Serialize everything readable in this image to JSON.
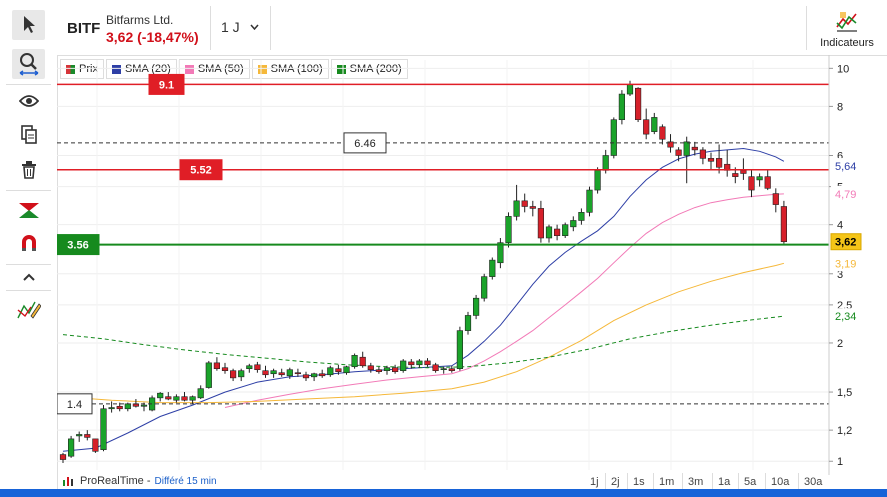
{
  "header": {
    "symbol": "BITF",
    "company": "Bitfarms Ltd.",
    "quote": "3,62 (-18,47%)",
    "period": "1 J",
    "indicators_label": "Indicateurs"
  },
  "toolbar": {
    "tools": [
      "cursor-icon",
      "zoom-icon",
      "eye-icon",
      "copy-icon",
      "trash-icon",
      "trend-icon",
      "magnet-icon",
      "chevron-up-icon",
      "pencil-icon"
    ]
  },
  "legend": [
    {
      "label": "Prix",
      "color": "#d6353a"
    },
    {
      "label": "SMA (20)",
      "color": "#2e3fa6"
    },
    {
      "label": "SMA (50)",
      "color": "#f27ab7"
    },
    {
      "label": "SMA (100)",
      "color": "#f5b83a"
    },
    {
      "label": "SMA (200)",
      "color": "#168a1e"
    }
  ],
  "price_lines": [
    {
      "label": "9.1",
      "value": 9.1,
      "color": "#e01e26",
      "style": "solid"
    },
    {
      "label": "6.46",
      "value": 6.46,
      "color": "#333333",
      "style": "dashed"
    },
    {
      "label": "5.52",
      "value": 5.52,
      "color": "#e01e26",
      "style": "solid"
    },
    {
      "label": "3.56",
      "value": 3.56,
      "color": "#168a1e",
      "style": "solid"
    },
    {
      "label": "1.4",
      "value": 1.4,
      "color": "#333333",
      "style": "dashed"
    }
  ],
  "axis_badges": [
    {
      "label": "5,64",
      "color": "#2e3fa6",
      "bg": "#ffffff",
      "value": 5.64
    },
    {
      "label": "4,79",
      "color": "#f27ab7",
      "bg": "#ffffff",
      "value": 4.79
    },
    {
      "label": "3,62",
      "color": "#000000",
      "bg": "#f5c518",
      "value": 3.62
    },
    {
      "label": "3,19",
      "color": "#f5b83a",
      "bg": "#ffffff",
      "value": 3.19
    },
    {
      "label": "2,34",
      "color": "#168a1e",
      "bg": "#ffffff",
      "value": 2.34
    }
  ],
  "footer": {
    "source": "ProRealTime -",
    "delay": "Différé 15 min",
    "ranges": [
      "1j",
      "2j",
      "1s",
      "1m",
      "3m",
      "1a",
      "5a",
      "10a",
      "30a"
    ]
  },
  "chart_data": {
    "type": "candlestick",
    "yscale": "log",
    "ylim": [
      0.95,
      10.5
    ],
    "yticks": [
      {
        "label": "10",
        "value": 10
      },
      {
        "label": "8",
        "value": 8
      },
      {
        "label": "6",
        "value": 6
      },
      {
        "label": "5",
        "value": 5
      },
      {
        "label": "4",
        "value": 4
      },
      {
        "label": "3",
        "value": 3
      },
      {
        "label": "2,5",
        "value": 2.5
      },
      {
        "label": "2",
        "value": 2
      },
      {
        "label": "1,5",
        "value": 1.5
      },
      {
        "label": "1,2",
        "value": 1.2
      },
      {
        "label": "1",
        "value": 1
      }
    ],
    "candles": [
      [
        1.04,
        1.05,
        0.99,
        1.01
      ],
      [
        1.03,
        1.16,
        1.02,
        1.14
      ],
      [
        1.16,
        1.19,
        1.12,
        1.17
      ],
      [
        1.17,
        1.2,
        1.13,
        1.15
      ],
      [
        1.14,
        1.14,
        1.05,
        1.06
      ],
      [
        1.07,
        1.39,
        1.06,
        1.36
      ],
      [
        1.36,
        1.42,
        1.33,
        1.37
      ],
      [
        1.38,
        1.41,
        1.34,
        1.36
      ],
      [
        1.36,
        1.41,
        1.34,
        1.4
      ],
      [
        1.4,
        1.44,
        1.37,
        1.38
      ],
      [
        1.38,
        1.41,
        1.34,
        1.39
      ],
      [
        1.35,
        1.47,
        1.34,
        1.45
      ],
      [
        1.45,
        1.5,
        1.42,
        1.49
      ],
      [
        1.46,
        1.5,
        1.43,
        1.44
      ],
      [
        1.43,
        1.48,
        1.41,
        1.46
      ],
      [
        1.46,
        1.5,
        1.42,
        1.43
      ],
      [
        1.43,
        1.47,
        1.4,
        1.46
      ],
      [
        1.45,
        1.56,
        1.44,
        1.53
      ],
      [
        1.54,
        1.8,
        1.53,
        1.78
      ],
      [
        1.78,
        1.84,
        1.7,
        1.72
      ],
      [
        1.73,
        1.78,
        1.67,
        1.7
      ],
      [
        1.7,
        1.72,
        1.6,
        1.63
      ],
      [
        1.64,
        1.72,
        1.6,
        1.7
      ],
      [
        1.72,
        1.77,
        1.68,
        1.75
      ],
      [
        1.76,
        1.79,
        1.68,
        1.71
      ],
      [
        1.7,
        1.75,
        1.63,
        1.66
      ],
      [
        1.67,
        1.72,
        1.63,
        1.7
      ],
      [
        1.68,
        1.72,
        1.64,
        1.66
      ],
      [
        1.65,
        1.73,
        1.62,
        1.71
      ],
      [
        1.68,
        1.72,
        1.64,
        1.67
      ],
      [
        1.66,
        1.69,
        1.6,
        1.63
      ],
      [
        1.64,
        1.68,
        1.6,
        1.67
      ],
      [
        1.67,
        1.71,
        1.63,
        1.65
      ],
      [
        1.66,
        1.75,
        1.64,
        1.73
      ],
      [
        1.72,
        1.76,
        1.66,
        1.69
      ],
      [
        1.68,
        1.75,
        1.66,
        1.74
      ],
      [
        1.74,
        1.88,
        1.72,
        1.86
      ],
      [
        1.84,
        1.9,
        1.73,
        1.75
      ],
      [
        1.75,
        1.78,
        1.68,
        1.71
      ],
      [
        1.71,
        1.74,
        1.67,
        1.69
      ],
      [
        1.7,
        1.75,
        1.66,
        1.73
      ],
      [
        1.73,
        1.76,
        1.67,
        1.69
      ],
      [
        1.7,
        1.82,
        1.68,
        1.8
      ],
      [
        1.79,
        1.82,
        1.72,
        1.76
      ],
      [
        1.76,
        1.82,
        1.73,
        1.8
      ],
      [
        1.8,
        1.83,
        1.74,
        1.76
      ],
      [
        1.76,
        1.78,
        1.68,
        1.7
      ],
      [
        1.71,
        1.74,
        1.67,
        1.72
      ],
      [
        1.72,
        1.75,
        1.68,
        1.7
      ],
      [
        1.72,
        2.2,
        1.7,
        2.15
      ],
      [
        2.15,
        2.4,
        2.1,
        2.35
      ],
      [
        2.35,
        2.65,
        2.3,
        2.6
      ],
      [
        2.6,
        3.0,
        2.55,
        2.95
      ],
      [
        2.95,
        3.3,
        2.9,
        3.25
      ],
      [
        3.2,
        3.7,
        3.1,
        3.6
      ],
      [
        3.6,
        4.3,
        3.5,
        4.2
      ],
      [
        4.2,
        5.05,
        4.1,
        4.6
      ],
      [
        4.6,
        4.8,
        4.3,
        4.45
      ],
      [
        4.45,
        4.6,
        4.2,
        4.4
      ],
      [
        4.4,
        4.6,
        3.6,
        3.7
      ],
      [
        3.7,
        4.0,
        3.6,
        3.95
      ],
      [
        3.9,
        4.0,
        3.65,
        3.75
      ],
      [
        3.75,
        4.05,
        3.7,
        4.0
      ],
      [
        3.95,
        4.2,
        3.85,
        4.1
      ],
      [
        4.1,
        4.4,
        4.0,
        4.3
      ],
      [
        4.3,
        5.0,
        4.2,
        4.9
      ],
      [
        4.9,
        5.6,
        4.8,
        5.5
      ],
      [
        5.5,
        6.2,
        5.4,
        6.0
      ],
      [
        6.0,
        7.5,
        5.9,
        7.4
      ],
      [
        7.4,
        8.8,
        7.2,
        8.6
      ],
      [
        8.6,
        9.3,
        8.5,
        9.1
      ],
      [
        8.9,
        8.95,
        7.3,
        7.4
      ],
      [
        7.4,
        7.9,
        6.6,
        6.8
      ],
      [
        6.9,
        7.7,
        6.8,
        7.5
      ],
      [
        7.1,
        7.2,
        6.4,
        6.6
      ],
      [
        6.5,
        6.8,
        6.1,
        6.3
      ],
      [
        6.2,
        6.3,
        5.8,
        6.0
      ],
      [
        6.0,
        6.7,
        5.1,
        6.5
      ],
      [
        6.3,
        6.5,
        6.0,
        6.2
      ],
      [
        6.2,
        6.3,
        5.7,
        5.9
      ],
      [
        5.9,
        6.1,
        5.5,
        5.8
      ],
      [
        5.9,
        6.4,
        5.4,
        5.6
      ],
      [
        5.7,
        6.2,
        5.3,
        5.5
      ],
      [
        5.4,
        5.6,
        5.1,
        5.3
      ],
      [
        5.5,
        5.9,
        5.2,
        5.4
      ],
      [
        5.3,
        5.5,
        4.7,
        4.9
      ],
      [
        5.2,
        5.4,
        5.0,
        5.3
      ],
      [
        5.3,
        5.5,
        4.9,
        4.95
      ],
      [
        4.8,
        4.95,
        4.3,
        4.5
      ],
      [
        4.45,
        4.6,
        3.58,
        3.62
      ]
    ],
    "series": [
      {
        "name": "SMA (20)",
        "color": "#2e3fa6",
        "points": [
          [
            0,
            1.06
          ],
          [
            4,
            1.08
          ],
          [
            8,
            1.18
          ],
          [
            12,
            1.3
          ],
          [
            16,
            1.39
          ],
          [
            20,
            1.5
          ],
          [
            24,
            1.59
          ],
          [
            28,
            1.64
          ],
          [
            32,
            1.66
          ],
          [
            36,
            1.69
          ],
          [
            40,
            1.71
          ],
          [
            44,
            1.73
          ],
          [
            48,
            1.75
          ],
          [
            50,
            1.86
          ],
          [
            52,
            2.02
          ],
          [
            54,
            2.22
          ],
          [
            56,
            2.5
          ],
          [
            58,
            2.82
          ],
          [
            60,
            3.14
          ],
          [
            62,
            3.4
          ],
          [
            64,
            3.63
          ],
          [
            66,
            3.86
          ],
          [
            68,
            4.2
          ],
          [
            70,
            4.72
          ],
          [
            72,
            5.2
          ],
          [
            74,
            5.6
          ],
          [
            76,
            5.88
          ],
          [
            78,
            6.05
          ],
          [
            80,
            6.15
          ],
          [
            82,
            6.2
          ],
          [
            84,
            6.25
          ],
          [
            86,
            6.15
          ],
          [
            88,
            5.95
          ],
          [
            89,
            5.8
          ]
        ]
      },
      {
        "name": "SMA (50)",
        "color": "#f27ab7",
        "points": [
          [
            20,
            1.37
          ],
          [
            24,
            1.43
          ],
          [
            28,
            1.48
          ],
          [
            32,
            1.53
          ],
          [
            36,
            1.57
          ],
          [
            40,
            1.61
          ],
          [
            44,
            1.64
          ],
          [
            48,
            1.67
          ],
          [
            50,
            1.72
          ],
          [
            52,
            1.8
          ],
          [
            54,
            1.9
          ],
          [
            56,
            2.02
          ],
          [
            58,
            2.15
          ],
          [
            60,
            2.32
          ],
          [
            62,
            2.5
          ],
          [
            64,
            2.7
          ],
          [
            66,
            2.92
          ],
          [
            68,
            3.2
          ],
          [
            70,
            3.5
          ],
          [
            72,
            3.8
          ],
          [
            74,
            4.05
          ],
          [
            76,
            4.25
          ],
          [
            78,
            4.42
          ],
          [
            80,
            4.55
          ],
          [
            82,
            4.63
          ],
          [
            84,
            4.7
          ],
          [
            86,
            4.74
          ],
          [
            88,
            4.78
          ],
          [
            89,
            4.79
          ]
        ]
      },
      {
        "name": "SMA (100)",
        "color": "#f5b83a",
        "points": [
          [
            0,
            1.46
          ],
          [
            6,
            1.43
          ],
          [
            12,
            1.41
          ],
          [
            18,
            1.41
          ],
          [
            24,
            1.42
          ],
          [
            30,
            1.44
          ],
          [
            36,
            1.46
          ],
          [
            42,
            1.49
          ],
          [
            48,
            1.53
          ],
          [
            52,
            1.59
          ],
          [
            56,
            1.69
          ],
          [
            60,
            1.84
          ],
          [
            64,
            2.03
          ],
          [
            68,
            2.28
          ],
          [
            72,
            2.5
          ],
          [
            76,
            2.7
          ],
          [
            80,
            2.87
          ],
          [
            84,
            3.02
          ],
          [
            88,
            3.15
          ],
          [
            89,
            3.19
          ]
        ]
      },
      {
        "name": "SMA (200)",
        "color": "#168a1e",
        "points": [
          [
            0,
            2.1
          ],
          [
            5,
            2.05
          ],
          [
            10,
            1.98
          ],
          [
            15,
            1.92
          ],
          [
            20,
            1.87
          ],
          [
            25,
            1.83
          ],
          [
            30,
            1.79
          ],
          [
            35,
            1.76
          ],
          [
            40,
            1.74
          ],
          [
            45,
            1.73
          ],
          [
            50,
            1.74
          ],
          [
            55,
            1.78
          ],
          [
            60,
            1.84
          ],
          [
            65,
            1.93
          ],
          [
            70,
            2.05
          ],
          [
            75,
            2.14
          ],
          [
            80,
            2.22
          ],
          [
            85,
            2.29
          ],
          [
            89,
            2.34
          ]
        ]
      }
    ]
  }
}
